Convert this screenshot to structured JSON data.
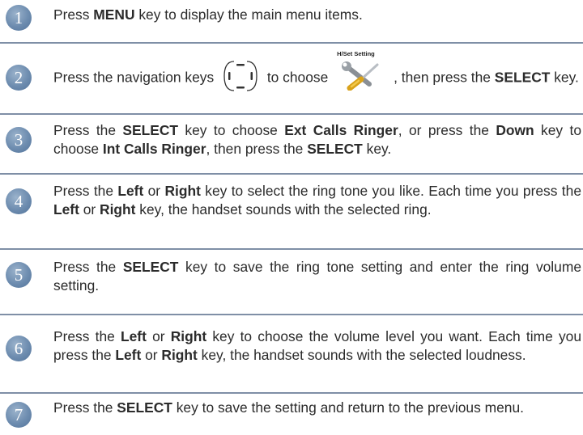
{
  "steps": [
    {
      "number": "1",
      "segments": [
        {
          "text": "Press ",
          "bold": false
        },
        {
          "text": "MENU",
          "bold": true
        },
        {
          "text": " key to display the main menu items.",
          "bold": false
        }
      ]
    },
    {
      "number": "2",
      "segments": [
        {
          "text": "Press the navigation keys ",
          "bold": false
        },
        {
          "icon": "navigation-keys-icon"
        },
        {
          "text": " to choose ",
          "bold": false
        },
        {
          "icon": "handset-setting-icon"
        },
        {
          "text": ", then press the ",
          "bold": false
        },
        {
          "text": "SELECT",
          "bold": true
        },
        {
          "text": " key.",
          "bold": false
        }
      ]
    },
    {
      "number": "3",
      "segments": [
        {
          "text": "Press the ",
          "bold": false
        },
        {
          "text": "SELECT",
          "bold": true
        },
        {
          "text": " key to choose ",
          "bold": false
        },
        {
          "text": "Ext Calls Ringer",
          "bold": true
        },
        {
          "text": ", or press the ",
          "bold": false
        },
        {
          "text": "Down",
          "bold": true
        },
        {
          "text": " key to choose ",
          "bold": false
        },
        {
          "text": "Int Calls Ringer",
          "bold": true
        },
        {
          "text": ", then press the ",
          "bold": false
        },
        {
          "text": "SELECT",
          "bold": true
        },
        {
          "text": " key.",
          "bold": false
        }
      ]
    },
    {
      "number": "4",
      "segments": [
        {
          "text": "Press the ",
          "bold": false
        },
        {
          "text": "Left",
          "bold": true
        },
        {
          "text": " or ",
          "bold": false
        },
        {
          "text": "Right",
          "bold": true
        },
        {
          "text": " key to select the ring tone you like. Each time you press the ",
          "bold": false
        },
        {
          "text": "Left",
          "bold": true
        },
        {
          "text": " or ",
          "bold": false
        },
        {
          "text": "Right",
          "bold": true
        },
        {
          "text": " key, the handset sounds with the selected ring.",
          "bold": false
        }
      ]
    },
    {
      "number": "5",
      "segments": [
        {
          "text": "Press the ",
          "bold": false
        },
        {
          "text": "SELECT",
          "bold": true
        },
        {
          "text": " key to save the ring tone setting and enter the ring volume setting.",
          "bold": false
        }
      ]
    },
    {
      "number": "6",
      "segments": [
        {
          "text": "Press the ",
          "bold": false
        },
        {
          "text": "Left",
          "bold": true
        },
        {
          "text": " or ",
          "bold": false
        },
        {
          "text": "Right",
          "bold": true
        },
        {
          "text": " key to choose the volume level you want. Each time you press the ",
          "bold": false
        },
        {
          "text": "Left",
          "bold": true
        },
        {
          "text": " or ",
          "bold": false
        },
        {
          "text": "Right",
          "bold": true
        },
        {
          "text": " key, the handset sounds with the selected loudness.",
          "bold": false
        }
      ]
    },
    {
      "number": "7",
      "segments": [
        {
          "text": "Press the ",
          "bold": false
        },
        {
          "text": "SELECT",
          "bold": true
        },
        {
          "text": " key to save the setting and return to the previous menu.",
          "bold": false
        }
      ]
    }
  ],
  "icons": {
    "handset_setting_label": "H/Set Setting"
  },
  "colors": {
    "badge": "#6d8caf",
    "separator": "#7f8fa6",
    "text": "#2b2b2b"
  }
}
